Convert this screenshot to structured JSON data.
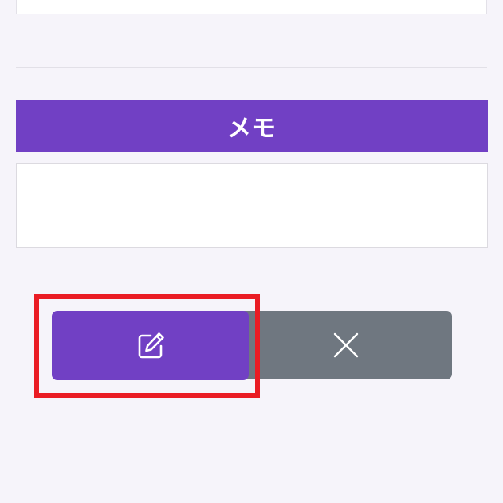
{
  "memo": {
    "header_label": "メモ",
    "text_value": ""
  },
  "actions": {
    "edit_icon": "edit-icon",
    "cancel_icon": "close-icon"
  },
  "colors": {
    "accent": "#7140c4",
    "cancel_bg": "#6f7780",
    "highlight": "#ea1c24",
    "page_bg": "#f6f4fa"
  }
}
